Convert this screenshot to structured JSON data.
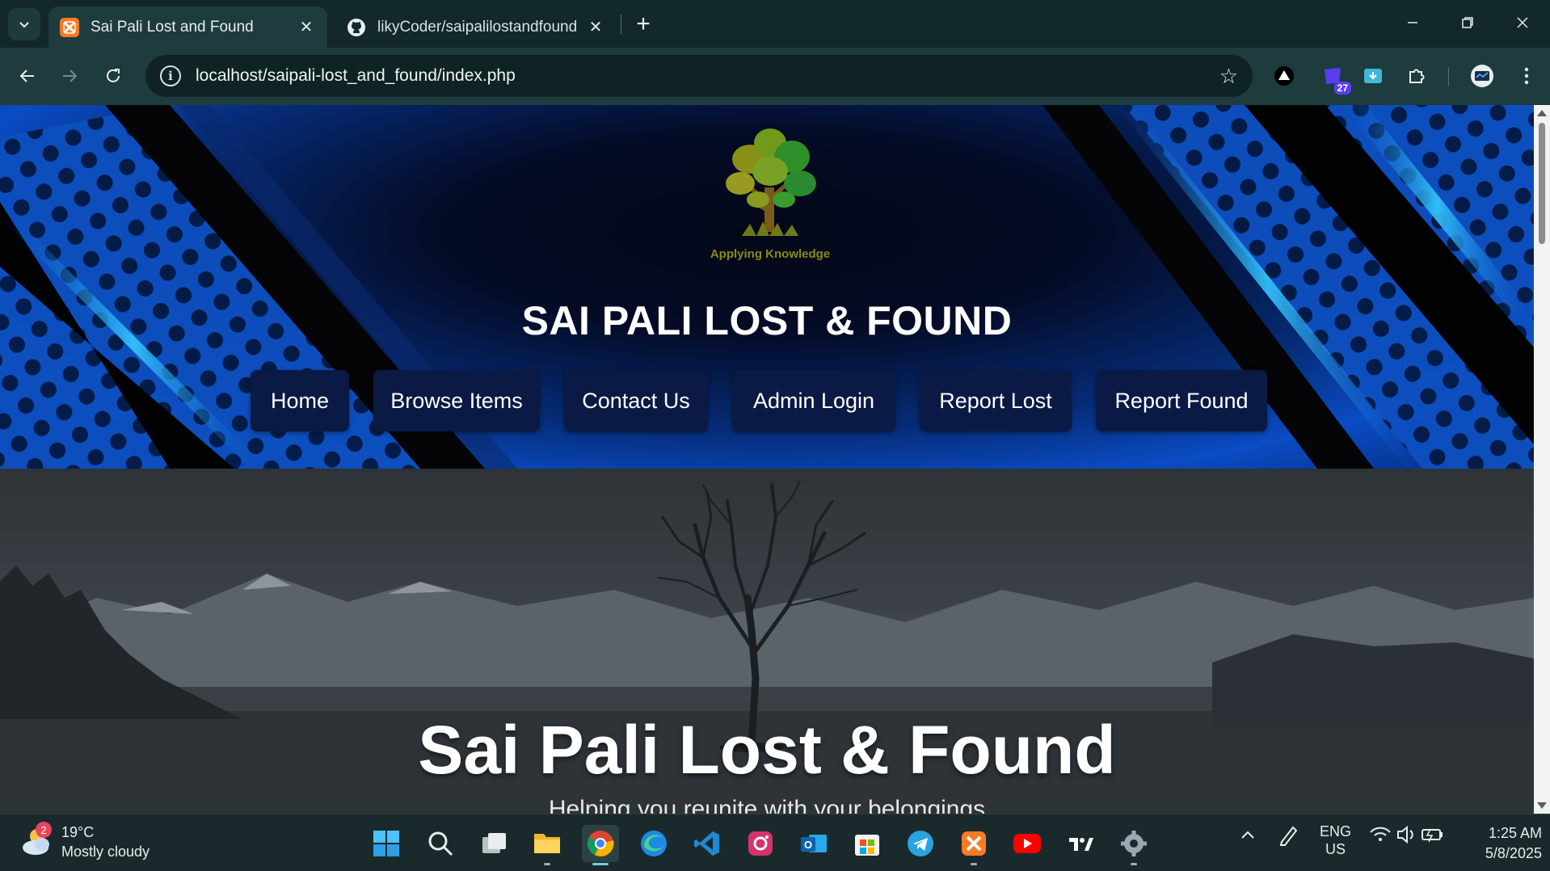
{
  "browser": {
    "tabs": [
      {
        "title": "Sai Pali Lost and Found",
        "icon": "xampp-icon",
        "active": true
      },
      {
        "title": "likyCoder/saipalilostandfound",
        "icon": "github-icon",
        "active": false
      }
    ],
    "new_tab_label": "+",
    "url": "localhost/saipali-lost_and_found/index.php",
    "extension_badge": "27"
  },
  "header": {
    "logo_text": "Applying Knowledge",
    "site_title": "SAI PALI LOST & FOUND",
    "nav": [
      {
        "label": "Home"
      },
      {
        "label": "Browse Items"
      },
      {
        "label": "Contact Us"
      },
      {
        "label": "Admin Login"
      },
      {
        "label": "Report Lost"
      },
      {
        "label": "Report Found"
      }
    ]
  },
  "hero": {
    "title": "Sai Pali Lost & Found",
    "subtitle": "Helping you reunite with your belongings"
  },
  "taskbar": {
    "weather": {
      "badge": "2",
      "temp": "19°C",
      "condition": "Mostly cloudy"
    },
    "apps": [
      "start",
      "search",
      "task-view",
      "file-explorer",
      "chrome",
      "edge",
      "vscode",
      "instagram",
      "outlook",
      "store",
      "telegram",
      "xampp",
      "youtube",
      "tradingview",
      "settings"
    ],
    "language": {
      "line1": "ENG",
      "line2": "US"
    },
    "time": "1:25 AM",
    "date": "5/8/2025"
  },
  "colors": {
    "chrome_bg": "#12282a",
    "toolbar_bg": "#1e3b3d",
    "nav_button_bg": "#0a1a45",
    "header_accent": "#0a4cc4"
  }
}
